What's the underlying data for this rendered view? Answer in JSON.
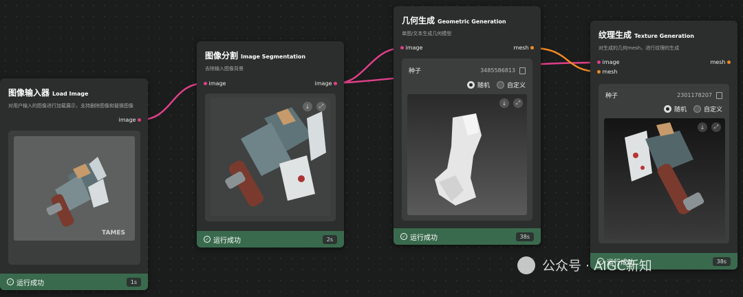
{
  "nodes": {
    "load_image": {
      "title_cn": "图像输入器",
      "title_en": "Load Image",
      "desc": "对用户输入的图像进行加载展示，支持删除图像和替换图像",
      "output_port": "image",
      "image_icon": "axe-image",
      "watermark_text": "TAMES",
      "status": "运行成功",
      "time": "1s"
    },
    "segmentation": {
      "title_cn": "图像分割",
      "title_en": "Image Segmentation",
      "desc": "去除输入图像背景",
      "input_port": "image",
      "output_port": "image",
      "status": "运行成功",
      "time": "2s"
    },
    "geometry": {
      "title_cn": "几何生成",
      "title_en": "Geometric Generation",
      "desc": "单图/文本生成几何模型",
      "input_port": "image",
      "output_port": "mesh",
      "seed_label": "种子",
      "seed_value": "3485586813",
      "radio_random": "随机",
      "radio_custom": "自定义",
      "status": "运行成功",
      "time": "38s"
    },
    "texture": {
      "title_cn": "纹理生成",
      "title_en": "Texture Generation",
      "desc": "对生成的几何mesh，进行纹理的生成",
      "input_image": "image",
      "input_mesh": "mesh",
      "output_port": "mesh",
      "seed_label": "种子",
      "seed_value": "2301178207",
      "radio_random": "随机",
      "radio_custom": "自定义",
      "status": "运行成功",
      "time": "38s"
    }
  },
  "watermark": {
    "text": "公众号 · AIGC新知"
  },
  "colors": {
    "wire_image": "#e0408a",
    "wire_mesh": "#f08a24",
    "status_bar": "#3a6a4d"
  },
  "icons": [
    "check-circle-icon",
    "download-icon",
    "fullscreen-icon",
    "copy-icon",
    "wechat-logo-icon"
  ]
}
